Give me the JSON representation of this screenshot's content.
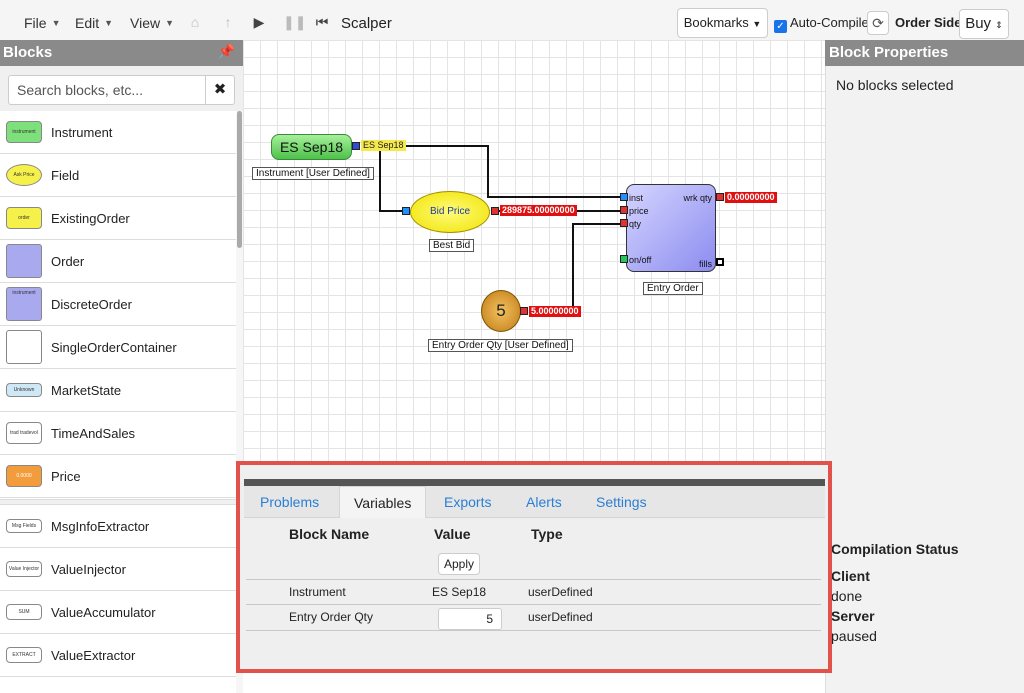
{
  "menu": [
    {
      "label": "File"
    },
    {
      "label": "Edit"
    },
    {
      "label": "View"
    }
  ],
  "toolbar": {
    "title": "Scalper",
    "bookmarks_label": "Bookmarks",
    "auto_compile_label": "Auto-Compile",
    "auto_compile_checked": true,
    "order_side_label": "Order Side",
    "order_side_value": "Buy"
  },
  "sidebar": {
    "title": "Blocks",
    "search_placeholder": "Search blocks, etc...",
    "items": [
      {
        "label": "Instrument",
        "thumb_text": "instrument",
        "thumb_color": "#7ee07a"
      },
      {
        "label": "Field",
        "thumb_text": "Ask Price",
        "thumb_color": "#f6f04a"
      },
      {
        "label": "ExistingOrder",
        "thumb_text": "order",
        "thumb_color": "#f6f04a"
      },
      {
        "label": "Order",
        "thumb_text": "",
        "thumb_color": "#a9a9f0"
      },
      {
        "label": "DiscreteOrder",
        "thumb_text": "instrument",
        "thumb_color": "#a9a9f0"
      },
      {
        "label": "SingleOrderContainer",
        "thumb_text": "",
        "thumb_color": "#ffffff"
      },
      {
        "label": "MarketState",
        "thumb_text": "Unknown",
        "thumb_color": "#cfe8f5"
      },
      {
        "label": "TimeAndSales",
        "thumb_text": "trad   tradevol",
        "thumb_color": "#ffffff"
      },
      {
        "label": "Price",
        "thumb_text": "0.0000",
        "thumb_color": "#f39c3c"
      },
      {
        "label": "MsgInfoExtractor",
        "thumb_text": "Msg Fields",
        "thumb_color": "#ffffff"
      },
      {
        "label": "ValueInjector",
        "thumb_text": "Value Injector",
        "thumb_color": "#ffffff"
      },
      {
        "label": "ValueAccumulator",
        "thumb_text": "SUM",
        "thumb_color": "#ffffff"
      },
      {
        "label": "ValueExtractor",
        "thumb_text": "EXTRACT",
        "thumb_color": "#ffffff"
      }
    ]
  },
  "canvas": {
    "instrument_node": {
      "label": "ES Sep18",
      "output": "ES Sep18",
      "caption": "Instrument [User Defined]"
    },
    "bid_node": {
      "label": "Bid Price",
      "output": "289875.00000000",
      "caption": "Best Bid"
    },
    "qty_node": {
      "label": "5",
      "output": "5.00000000",
      "caption": "Entry Order Qty [User Defined]"
    },
    "order_node": {
      "caption": "Entry Order",
      "inputs": [
        "inst",
        "price",
        "qty",
        "on/off"
      ],
      "outputs": [
        "wrk qty",
        "fills"
      ],
      "wrk_qty_value": "0.00000000"
    }
  },
  "properties": {
    "title": "Block Properties",
    "empty_text": "No blocks selected",
    "compilation_title": "Compilation Status",
    "client_label": "Client",
    "client_value": "done",
    "server_label": "Server",
    "server_value": "paused"
  },
  "bottom_panel": {
    "tabs": [
      {
        "label": "Problems",
        "active": false
      },
      {
        "label": "Variables",
        "active": true
      },
      {
        "label": "Exports",
        "active": false
      },
      {
        "label": "Alerts",
        "active": false
      },
      {
        "label": "Settings",
        "active": false
      }
    ],
    "columns": [
      "Block Name",
      "Value",
      "Type"
    ],
    "apply_label": "Apply",
    "rows": [
      {
        "name": "Instrument",
        "value": "ES Sep18",
        "type": "userDefined",
        "editable": false
      },
      {
        "name": "Entry Order Qty",
        "value": "5",
        "type": "userDefined",
        "editable": true
      }
    ]
  },
  "colors": {
    "panel_header": "#8a8a8a",
    "highlight_border": "#e0524a",
    "tab_link": "#2a7fd4",
    "output_red": "#e01010"
  }
}
